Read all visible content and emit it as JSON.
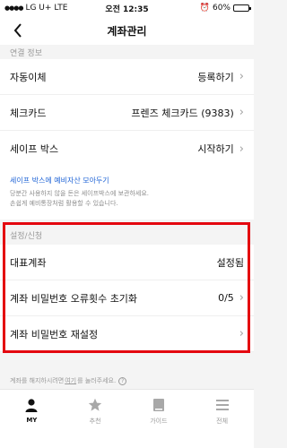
{
  "status_bar": {
    "carrier": "LG U+",
    "network": "LTE",
    "time": "오전 12:35",
    "battery_percent": "60%",
    "battery_level": 0.6
  },
  "nav": {
    "back_icon": "chevron-left-icon",
    "title": "계좌관리"
  },
  "sections": {
    "partial_header": "연결 정보",
    "settings_header": "설정/신청"
  },
  "rows": {
    "autotransfer": {
      "label": "자동이체",
      "value": "등록하기"
    },
    "checkcard": {
      "label": "체크카드",
      "value": "프렌즈 체크카드 (9383)"
    },
    "safebox": {
      "label": "세이프 박스",
      "value": "시작하기"
    },
    "main_account": {
      "label": "대표계좌",
      "value": "설정됨"
    },
    "pw_reset_count": {
      "label": "계좌 비밀번호 오류횟수 초기화",
      "value": "0/5"
    },
    "pw_reset": {
      "label": "계좌 비밀번호 재설정"
    }
  },
  "safebox_info": {
    "link": "세이프 박스에 예비자산 모아두기",
    "desc_line1": "당분간 사용하지 않을 돈은 세이프박스에 보관하세요.",
    "desc_line2": "손쉽게 예비통장처럼 활용할 수 있습니다."
  },
  "footer": {
    "prefix": "계좌를 해지하시려면",
    "link": "여기",
    "suffix": "를 눌러주세요.",
    "help_icon": "question-circle-icon"
  },
  "tabs": [
    {
      "label": "MY",
      "icon": "person-icon",
      "active": true
    },
    {
      "label": "추천",
      "icon": "star-icon",
      "active": false
    },
    {
      "label": "가이드",
      "icon": "book-icon",
      "active": false
    },
    {
      "label": "전체",
      "icon": "menu-icon",
      "active": false
    }
  ],
  "colors": {
    "highlight_frame": "#e4060f",
    "link": "#1e63d6"
  }
}
